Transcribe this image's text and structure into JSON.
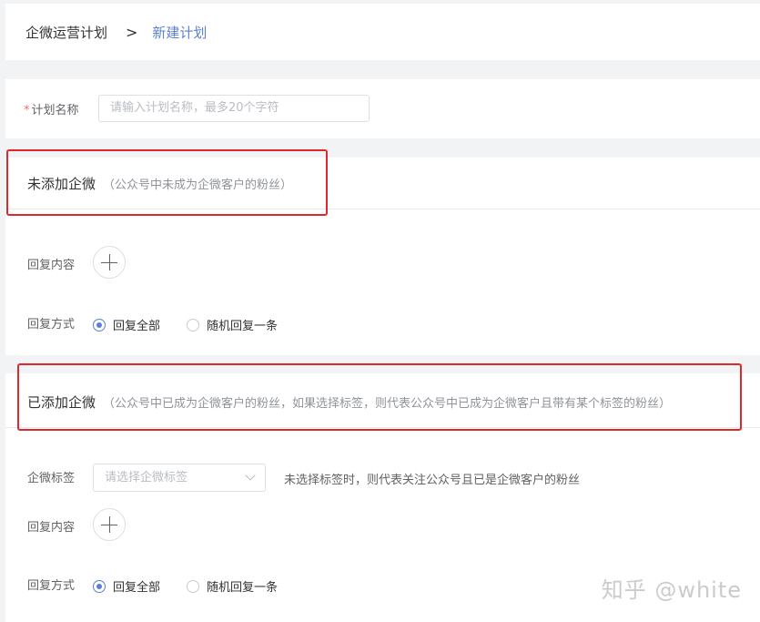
{
  "breadcrumb": {
    "root": "企微运营计划",
    "separator": ">",
    "current": "新建计划"
  },
  "plan_name": {
    "required_mark": "*",
    "label": "计划名称",
    "placeholder": "请输入计划名称，最多20个字符"
  },
  "section_unadded": {
    "title": "未添加企微",
    "note": "（公众号中未成为企微客户的粉丝）",
    "reply_content_label": "回复内容",
    "reply_mode_label": "回复方式",
    "options": [
      {
        "label": "回复全部",
        "checked": true
      },
      {
        "label": "随机回复一条",
        "checked": false
      }
    ]
  },
  "section_added": {
    "title": "已添加企微",
    "note": "（公众号中已成为企微客户的粉丝，如果选择标签，则代表公众号中已成为企微客户且带有某个标签的粉丝）",
    "tag_label": "企微标签",
    "tag_placeholder": "请选择企微标签",
    "tag_hint": "未选择标签时，则代表关注公众号且已是企微客户的粉丝",
    "reply_content_label": "回复内容",
    "reply_mode_label": "回复方式",
    "options": [
      {
        "label": "回复全部",
        "checked": true
      },
      {
        "label": "随机回复一条",
        "checked": false
      }
    ]
  },
  "watermark": "知乎 @white",
  "colors": {
    "accent": "#5b7fd6",
    "highlight_border": "#e0282c",
    "required": "#f56c6c"
  }
}
